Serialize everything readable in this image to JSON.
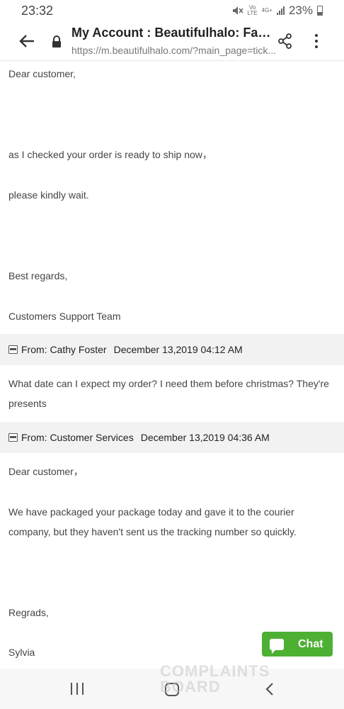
{
  "status_bar": {
    "time": "23:32",
    "volte_label_top": "Vo",
    "volte_label_bottom": "LTE",
    "network_label": "4G+",
    "battery_percent": "23%"
  },
  "toolbar": {
    "title": "My Account : Beautifulhalo: Fashi...",
    "url": "https://m.beautifulhalo.com/?main_page=tick..."
  },
  "messages": {
    "reply1": {
      "greeting": "Dear customer,",
      "line1": "as I checked your order is ready to ship now，",
      "line2": "please kindly wait.",
      "closing": "Best regards,",
      "signature": "Customers Support Team"
    },
    "header1": {
      "from": "From: Cathy Foster",
      "date": "December 13,2019 04:12 AM"
    },
    "question": {
      "line1": "What date can I expect my order? I need them before christmas? They're",
      "line2": "presents"
    },
    "header2": {
      "from": "From: Customer Services",
      "date": "December 13,2019 04:36 AM"
    },
    "reply2": {
      "greeting": "Dear customer，",
      "line1": "We have packaged your package today and gave it to the courier",
      "line2": "company, but they haven't sent us the tracking  number so quickly.",
      "closing": "Regrads,",
      "signature": "Sylvia"
    }
  },
  "chat": {
    "label": "Chat",
    "color": "#4db033"
  },
  "watermark": {
    "line1": "COMPLAINTS",
    "line2": "BOARD"
  },
  "icons": [
    "back-arrow-icon",
    "lock-icon",
    "share-icon",
    "more-vert-icon",
    "mail-icon",
    "chat-bubble-icon",
    "recent-apps-icon",
    "home-icon",
    "nav-back-icon"
  ]
}
